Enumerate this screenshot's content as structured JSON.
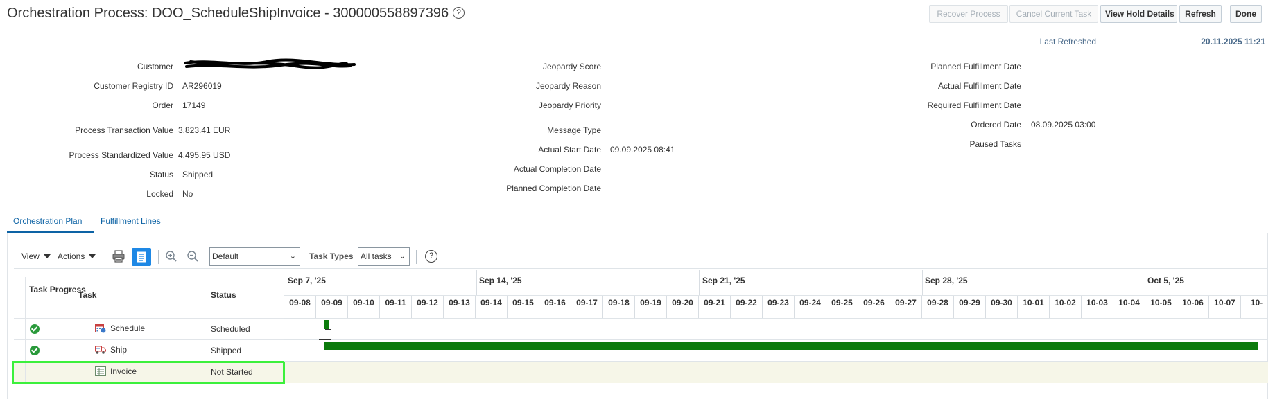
{
  "header": {
    "title": "Orchestration Process: DOO_ScheduleShipInvoice - 300000558897396",
    "help_glyph": "?",
    "buttons": {
      "recover": "Recover Process",
      "cancel_task": "Cancel Current Task",
      "view_hold": "View Hold Details",
      "refresh": "Refresh",
      "done": "Done"
    },
    "last_refreshed_label": "Last Refreshed",
    "last_refreshed_value": "20.11.2025 11:21"
  },
  "details": {
    "col1": {
      "customer_label": "Customer",
      "customer_value": "",
      "registry_label": "Customer Registry ID",
      "registry_value": "AR296019",
      "order_label": "Order",
      "order_value": "17149",
      "ptv_label": "Process Transaction Value",
      "ptv_value": "3,823.41 EUR",
      "psv_label": "Process Standardized Value",
      "psv_value": "4,495.95 USD",
      "status_label": "Status",
      "status_value": "Shipped",
      "locked_label": "Locked",
      "locked_value": "No"
    },
    "col2": {
      "jeopardy_score_label": "Jeopardy Score",
      "jeopardy_reason_label": "Jeopardy Reason",
      "jeopardy_priority_label": "Jeopardy Priority",
      "message_type_label": "Message Type",
      "actual_start_label": "Actual Start Date",
      "actual_start_value": "09.09.2025 08:41",
      "actual_completion_label": "Actual Completion Date",
      "planned_completion_label": "Planned Completion Date"
    },
    "col3": {
      "planned_fulfill_label": "Planned Fulfillment Date",
      "actual_fulfill_label": "Actual Fulfillment Date",
      "required_fulfill_label": "Required Fulfillment Date",
      "ordered_label": "Ordered Date",
      "ordered_value": "08.09.2025 03:00",
      "paused_label": "Paused Tasks"
    }
  },
  "tabs": {
    "orchestration_plan": "Orchestration Plan",
    "fulfillment_lines": "Fulfillment Lines"
  },
  "toolbar": {
    "view": "View",
    "actions": "Actions",
    "zoom_select": "Default",
    "task_types_label": "Task Types",
    "task_types_select": "All tasks",
    "help_glyph": "?"
  },
  "table": {
    "col_progress": "Task Progress",
    "col_task": "Task",
    "col_status": "Status",
    "rows": [
      {
        "task": "Schedule",
        "status": "Scheduled"
      },
      {
        "task": "Ship",
        "status": "Shipped"
      },
      {
        "task": "Invoice",
        "status": "Not Started"
      }
    ]
  },
  "gantt": {
    "weeks": [
      "Sep 7, '25",
      "Sep 14, '25",
      "Sep 21, '25",
      "Sep 28, '25",
      "Oct 5, '25"
    ],
    "days": [
      "09-08",
      "09-09",
      "09-10",
      "09-11",
      "09-12",
      "09-13",
      "09-14",
      "09-15",
      "09-16",
      "09-17",
      "09-18",
      "09-19",
      "09-20",
      "09-21",
      "09-22",
      "09-23",
      "09-24",
      "09-25",
      "09-26",
      "09-27",
      "09-28",
      "09-29",
      "09-30",
      "10-01",
      "10-02",
      "10-03",
      "10-04",
      "10-05",
      "10-06",
      "10-07",
      "10-"
    ]
  },
  "colors": {
    "accent": "#0d63a5",
    "bar": "#0b7a0b",
    "highlight": "#3cf03c"
  }
}
